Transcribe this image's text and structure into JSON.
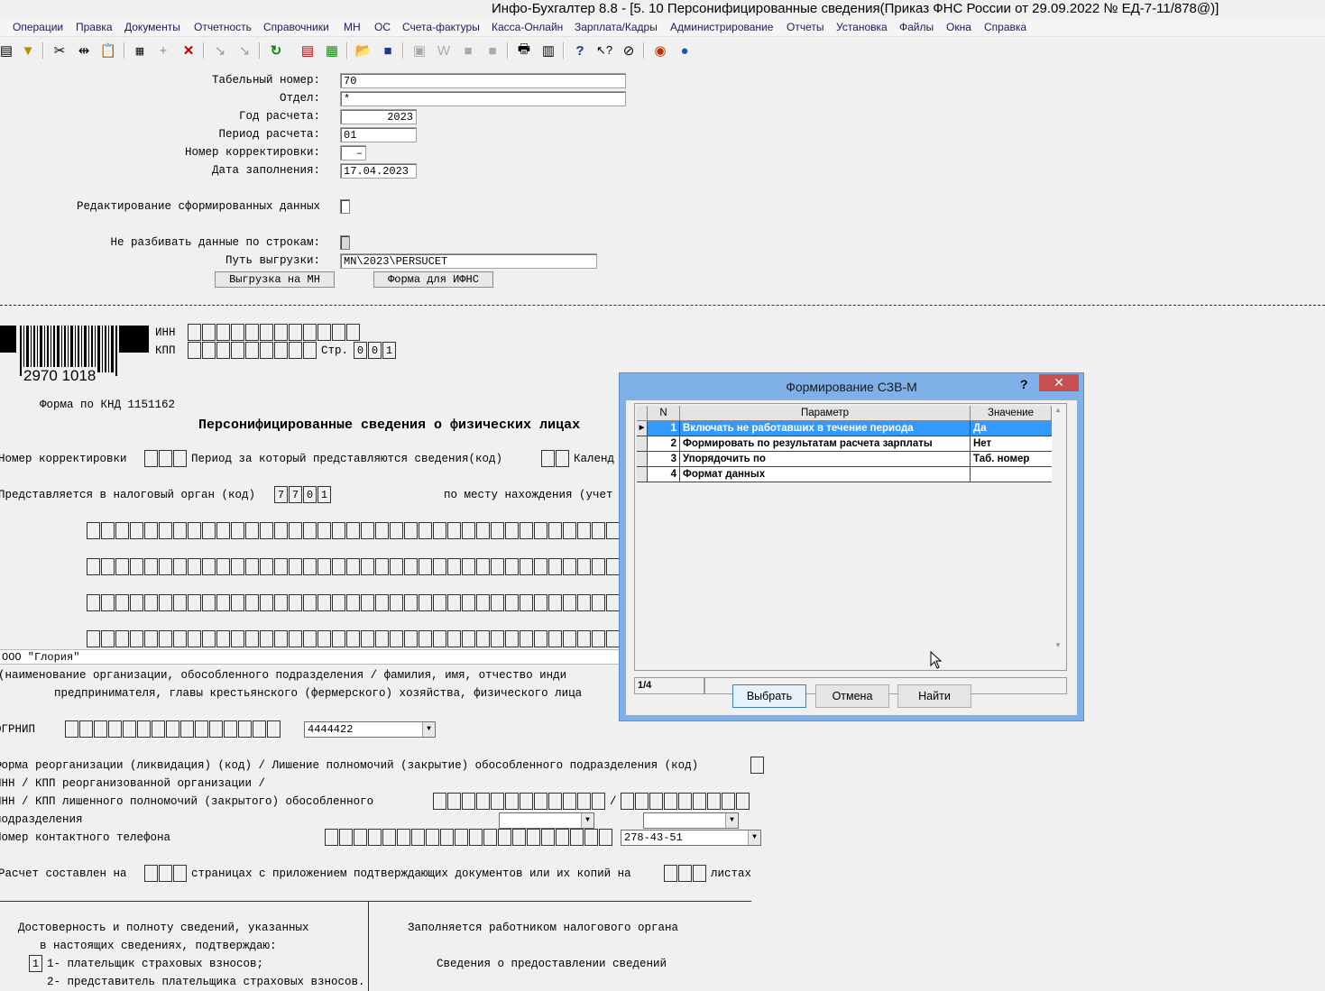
{
  "window": {
    "title": "Инфо-Бухгалтер 8.8 - [5. 10 Персонифицированные сведения(Приказ ФНС России от 29.09.2022 № ЕД-7-11/878@)]"
  },
  "menu": [
    "Операции",
    "Правка",
    "Документы",
    "Отчетность",
    "Справочники",
    "МН",
    "ОС",
    "Счета-фактуры",
    "Касса-Онлайн",
    "Зарплата/Кадры",
    "Администрирование",
    "Отчеты",
    "Установка",
    "Файлы",
    "Окна",
    "Справка"
  ],
  "form": {
    "tab_no_label": "Табельный номер:",
    "tab_no": "70",
    "dept_label": "Отдел:",
    "dept": "*",
    "year_label": "Год расчета:",
    "year": "2023",
    "period_label": "Период расчета:",
    "period": "01",
    "corr_label": "Номер корректировки:",
    "corr": "–",
    "date_label": "Дата заполнения:",
    "date": "17.04.2023",
    "edit_label": "Редактирование сформированных данных",
    "nosplit_label": "Не разбивать данные по строкам:",
    "path_label": "Путь выгрузки:",
    "path": "MN\\2023\\PERSUCET",
    "btn_export": "Выгрузка на МН",
    "btn_form": "Форма для ИФНС"
  },
  "doc": {
    "barcode_num": "2970 1018",
    "inn": "ИНН",
    "kpp": "КПП",
    "page_label": "Стр.",
    "page_cells": [
      "0",
      "0",
      "1"
    ],
    "knd": "Форма по КНД 1151162",
    "heading": "Персонифицированные сведения о физических лицах",
    "corr_no": "Номер корректировки",
    "period_text": "Период за который представляются сведения(код)",
    "calendar_text": "Календ",
    "tax_organ": "Представляется в налоговый орган (код)",
    "tax_cells": [
      "7",
      "7",
      "0",
      "1"
    ],
    "place": "по месту нахождения (учет",
    "org_name": "ООО \"Глория\"",
    "org_note1": "(наименование организации, обособленного подразделения  / фамилия, имя, отчество   инди",
    "org_note2": "предпринимателя, главы крестьянского (фермерского) хозяйства, физического лица",
    "ogrnip": "ОГРНИП",
    "ogrnip_value": "4444422",
    "reorg": "Форма реорганизации (ликвидация) (код) / Лишение полномочий (закрытие) обособленного подразделения (код)",
    "inn_kpp_reorg": "ИНН / КПП реорганизованной организации /",
    "inn_kpp_closed": "ИНН / КПП лишенного полномочий (закрытого) обособленного",
    "subdiv": "подразделения",
    "phone_label": "Номер контактного телефона",
    "phone": "278-43-51",
    "calc_text": "Расчет составлен на",
    "pages_text": "страницах с приложением подтверждающих документов или их копий на",
    "sheets_text": "листах",
    "confirm1": "Достоверность и полноту сведений, указанных",
    "confirm2": "в настоящих сведениях, подтверждаю:",
    "opt1_cell": "1",
    "opt1": "1- плательщик страховых взносов;",
    "opt2": "2- представитель плательщика страховых взносов.",
    "tax_worker": "Заполняется работником налогового органа",
    "info_submit": "Сведения о предоставлении сведений"
  },
  "dialog": {
    "title": "Формирование СЗВ-М",
    "help": "?",
    "close": "✕",
    "col_n": "N",
    "col_param": "Параметр",
    "col_value": "Значение",
    "rows": [
      {
        "n": "1",
        "param": "Включать не работавших в течение периода",
        "value": "Да"
      },
      {
        "n": "2",
        "param": "Формировать по результатам расчета зарплаты",
        "value": "Нет"
      },
      {
        "n": "3",
        "param": "Упорядочить по",
        "value": "Таб. номер"
      },
      {
        "n": "4",
        "param": "Формат данных",
        "value": ""
      }
    ],
    "counter": "1/4",
    "btn_select": "Выбрать",
    "btn_cancel": "Отмена",
    "btn_find": "Найти"
  }
}
